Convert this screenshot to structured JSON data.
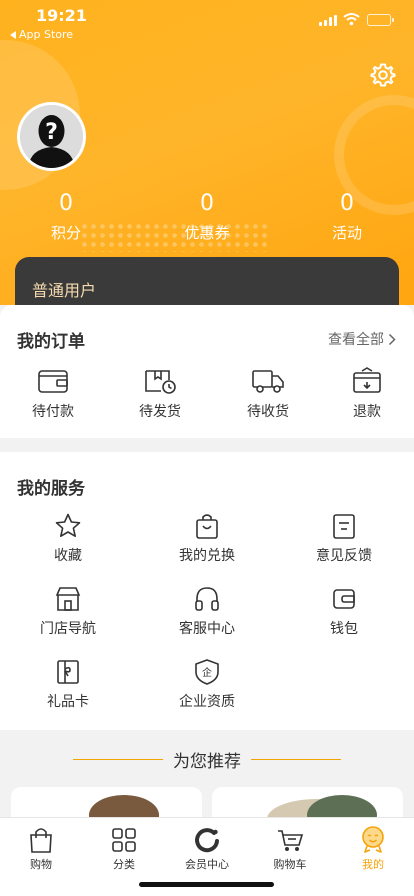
{
  "status_bar": {
    "time": "19:21",
    "back_label": "App Store"
  },
  "profile": {
    "stats": [
      {
        "value": "0",
        "label": "积分"
      },
      {
        "value": "0",
        "label": "优惠券"
      },
      {
        "value": "0",
        "label": "活动"
      }
    ],
    "member_level": "普通用户"
  },
  "orders": {
    "title": "我的订单",
    "see_all": "查看全部",
    "items": [
      {
        "label": "待付款",
        "icon": "wallet-icon"
      },
      {
        "label": "待发货",
        "icon": "package-clock-icon"
      },
      {
        "label": "待收货",
        "icon": "truck-icon"
      },
      {
        "label": "退款",
        "icon": "refund-icon"
      }
    ]
  },
  "services": {
    "title": "我的服务",
    "items": [
      {
        "label": "收藏",
        "icon": "star-icon"
      },
      {
        "label": "我的兑换",
        "icon": "shopping-bag-icon"
      },
      {
        "label": "意见反馈",
        "icon": "feedback-icon"
      },
      {
        "label": "门店导航",
        "icon": "store-icon"
      },
      {
        "label": "客服中心",
        "icon": "headphones-icon"
      },
      {
        "label": "钱包",
        "icon": "wallet-icon"
      },
      {
        "label": "礼品卡",
        "icon": "gift-card-icon"
      },
      {
        "label": "企业资质",
        "icon": "badge-icon"
      }
    ]
  },
  "recommend": {
    "title": "为您推荐"
  },
  "tabbar": {
    "active": "我的",
    "items": [
      {
        "label": "购物",
        "icon": "bag-icon"
      },
      {
        "label": "分类",
        "icon": "grid-icon"
      },
      {
        "label": "会员中心",
        "icon": "member-icon"
      },
      {
        "label": "购物车",
        "icon": "cart-icon"
      },
      {
        "label": "我的",
        "icon": "profile-icon"
      }
    ]
  },
  "colors": {
    "accent": "#f5a30a",
    "hero": "#ffb21e",
    "member_card": "#3a3a3a",
    "member_text": "#f5dbb0"
  }
}
